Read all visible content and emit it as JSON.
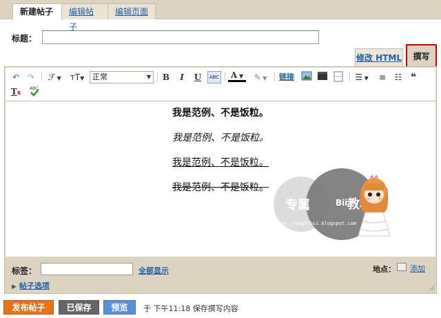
{
  "tabs": [
    {
      "label": "新建帖子",
      "active": true
    },
    {
      "label": "编辑帖子",
      "active": false
    },
    {
      "label": "编辑页面",
      "active": false
    }
  ],
  "title_field": {
    "label": "标题：",
    "value": ""
  },
  "mode_tabs": {
    "html_label": "修改 HTML",
    "compose_label": "撰写"
  },
  "toolbar": {
    "undo_icon": "↶",
    "redo_icon": "↷",
    "font_icon": "ℱ",
    "font_size_icon": "ᴛT",
    "format_select": "正常",
    "bold": "B",
    "italic": "I",
    "underline": "U",
    "strike": "ABC",
    "text_color": "A",
    "link": "链接",
    "quote": "❝"
  },
  "content_lines": [
    "我是范例、不是饭粒。",
    "我是范例、不是饭粒。",
    "我是范例、不是饭粒。",
    "我是范例、不是饭粒。"
  ],
  "watermark": {
    "chars": [
      "专属",
      "Bii",
      "教程"
    ],
    "url": "http://dog87bii.blogspot.com"
  },
  "labels": {
    "label": "标签：",
    "value": "",
    "show_all": "全部显示"
  },
  "location": {
    "label": "地点：",
    "add": "添加"
  },
  "post_options": "帖子选项",
  "actions": {
    "publish": "发布帖子",
    "saved": "已保存",
    "preview": "预览"
  },
  "save_status": "于 下午11:18 保存撰写内容",
  "colors": {
    "publish": "#e8711c",
    "saved": "#666666",
    "preview": "#5a8fdc",
    "frame": "#ddd3c1",
    "highlight": "#d40000"
  }
}
